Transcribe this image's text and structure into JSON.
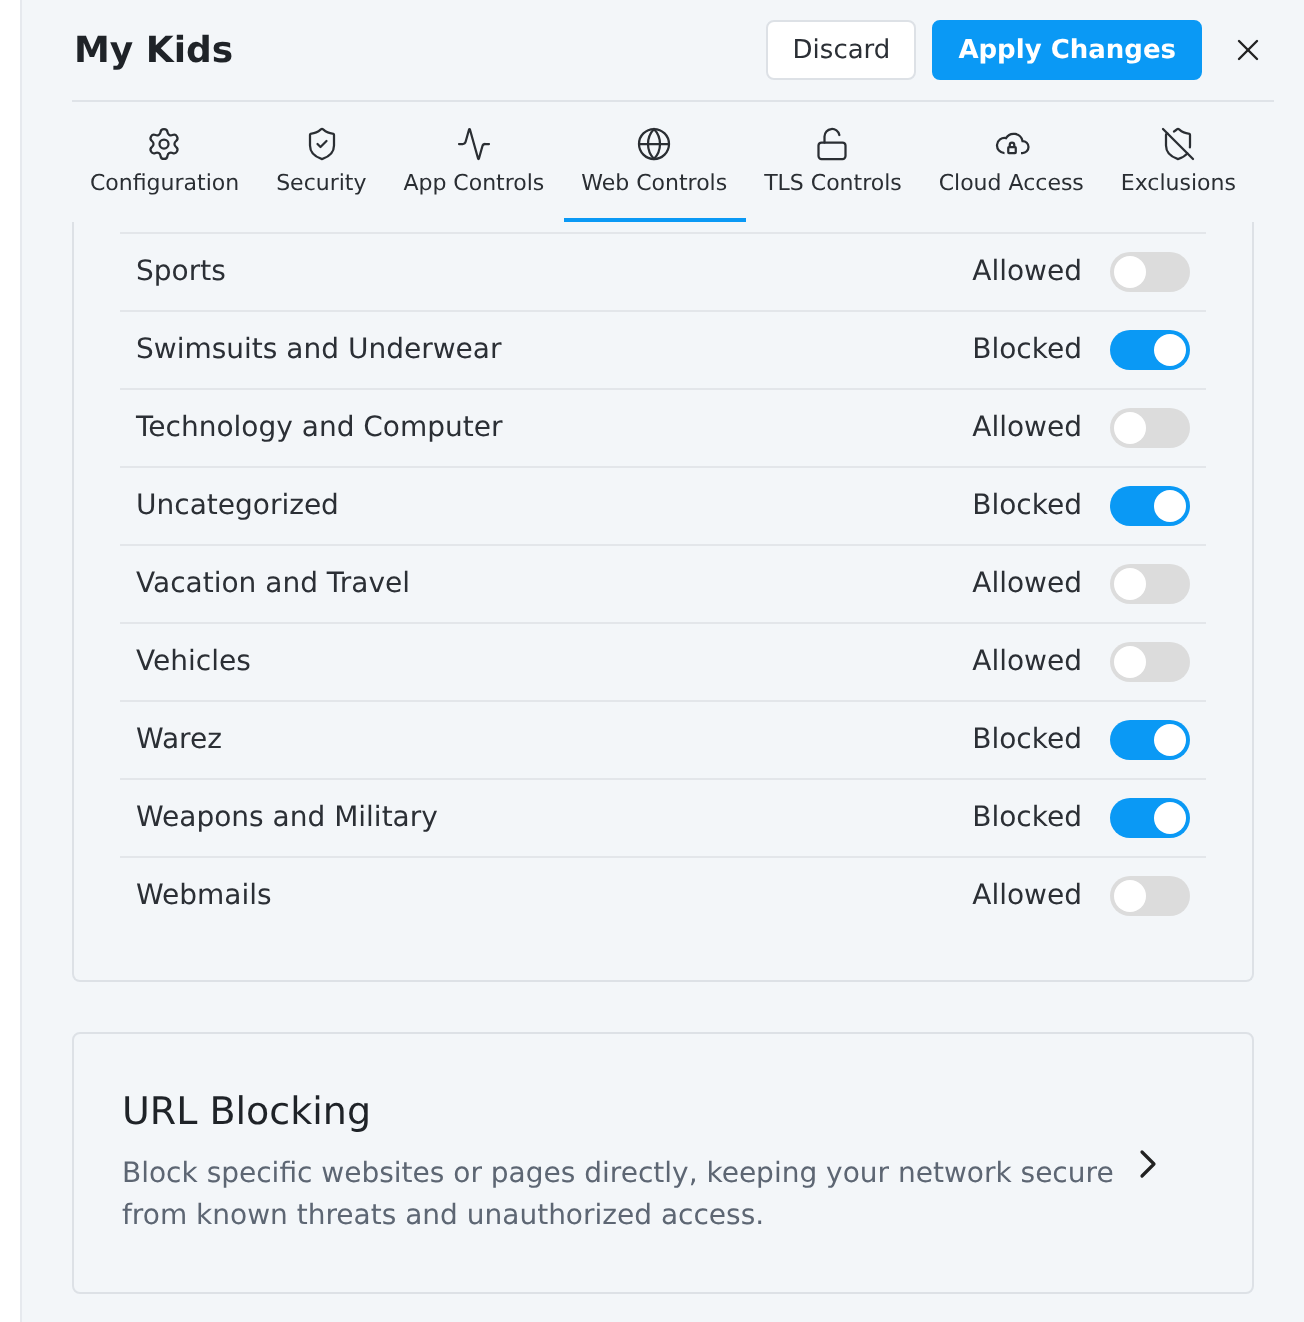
{
  "header": {
    "title": "My Kids",
    "buttons": [
      {
        "label": "Discard",
        "kind": "secondary"
      },
      {
        "label": "Apply Changes",
        "kind": "primary"
      }
    ]
  },
  "tabs": [
    {
      "label": "Configuration",
      "kind": "configuration",
      "selected": false
    },
    {
      "label": "Security",
      "kind": "security",
      "selected": false
    },
    {
      "label": "App Controls",
      "kind": "app",
      "selected": false
    },
    {
      "label": "Web Controls",
      "kind": "web",
      "selected": true
    },
    {
      "label": "TLS Controls",
      "kind": "tls",
      "selected": false
    },
    {
      "label": "Cloud Access",
      "kind": "cloud",
      "selected": false
    },
    {
      "label": "Exclusions",
      "kind": "exclusions",
      "selected": false
    }
  ],
  "categories": [
    {
      "name": "Sports",
      "status": "Allowed",
      "blocked": false
    },
    {
      "name": "Swimsuits and Underwear",
      "status": "Blocked",
      "blocked": true
    },
    {
      "name": "Technology and Computer",
      "status": "Allowed",
      "blocked": false
    },
    {
      "name": "Uncategorized",
      "status": "Blocked",
      "blocked": true
    },
    {
      "name": "Vacation and Travel",
      "status": "Allowed",
      "blocked": false
    },
    {
      "name": "Vehicles",
      "status": "Allowed",
      "blocked": false
    },
    {
      "name": "Warez",
      "status": "Blocked",
      "blocked": true
    },
    {
      "name": "Weapons and Military",
      "status": "Blocked",
      "blocked": true
    },
    {
      "name": "Webmails",
      "status": "Allowed",
      "blocked": false
    }
  ],
  "url_blocking": {
    "title": "URL Blocking",
    "description": "Block specific websites or pages directly, keeping your network secure from known threats and unauthorized access."
  }
}
